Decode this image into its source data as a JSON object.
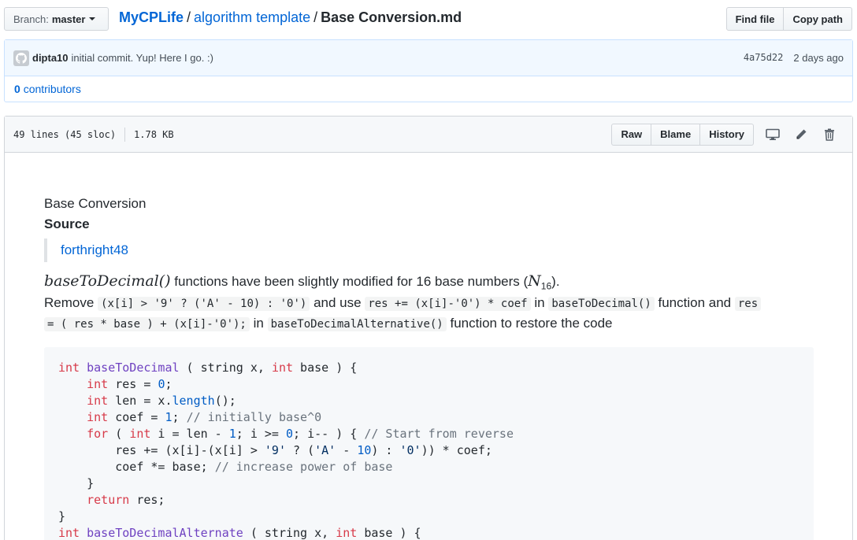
{
  "topbar": {
    "branch_label": "Branch:",
    "branch_value": "master",
    "breadcrumb": {
      "repo": "MyCPLife",
      "folder": "algorithm template",
      "file": "Base Conversion.md",
      "sep": "/"
    },
    "find_file": "Find file",
    "copy_path": "Copy path"
  },
  "commit": {
    "author": "dipta10",
    "message": "initial commit. Yup! Here I go. :)",
    "sha": "4a75d22",
    "time": "2 days ago"
  },
  "contributors": {
    "count": "0",
    "label": "contributors"
  },
  "file_header": {
    "lines": "49 lines (45 sloc)",
    "size": "1.78 KB",
    "raw": "Raw",
    "blame": "Blame",
    "history": "History",
    "icons": [
      "desktop-icon",
      "pencil-icon",
      "trash-icon"
    ]
  },
  "markdown": {
    "title": "Base Conversion",
    "source_heading": "Source",
    "source_link": "forthright48",
    "intro_fn": "baseToDecimal()",
    "intro_text": " functions have been slightly modified for 16 base numbers (",
    "intro_math": "N",
    "intro_sub": "16",
    "intro_end": ").",
    "remove_word": "Remove",
    "code1": "(x[i] > '9' ? ('A' - 10) : '0')",
    "and_use": "and use",
    "code2": "res += (x[i]-'0') * coef",
    "in_word": "in",
    "code3": "baseToDecimal()",
    "function_and": "function and",
    "code4a": "res",
    "code4b": "= ( res * base ) + (x[i]-'0');",
    "in_word2": "in",
    "code5": "baseToDecimalAlternative()",
    "restore": "function to restore the code"
  },
  "colors": {
    "link": "#0366d6",
    "keyword": "#d73a49",
    "function": "#6f42c1",
    "number": "#005cc5",
    "comment": "#6a737d",
    "string": "#032f62"
  }
}
